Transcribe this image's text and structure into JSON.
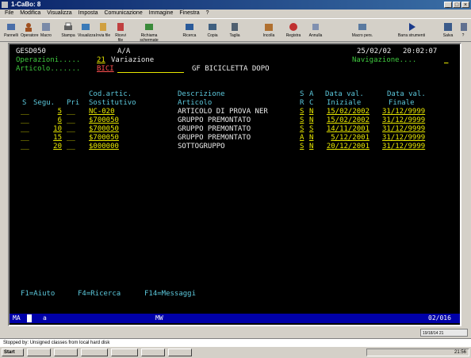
{
  "window": {
    "title": "1-CaBo: 8"
  },
  "menu": {
    "items": [
      "File",
      "Modifica",
      "Visualizza",
      "Imposta",
      "Comunicazione",
      "Immagine",
      "Finestra",
      "?"
    ]
  },
  "toolbar": {
    "buttons": [
      "Pannelli",
      "Operatore",
      "Macro",
      "Stampa",
      "Visualizza",
      "Invia file",
      "Ricevi file",
      "Richiama schermate",
      "Ricerca",
      "Copia",
      "Taglia",
      "Incolla",
      "Registra",
      "Annulla",
      "Macro pers.",
      "Barra strumenti",
      "Salva",
      "?"
    ]
  },
  "screen": {
    "program_id": "GESD050",
    "mode_code": "A/A",
    "date": "25/02/02",
    "time": "20:02:07",
    "operazioni_label": "Operazioni.....",
    "operazioni_value": "21",
    "operazioni_desc": "Variazione",
    "navigazione_label": "Navigazione....",
    "navigazione_value": "_",
    "articolo_label": "Articolo.......",
    "articolo_value": "BICI",
    "articolo_desc": "GF BICICLETTA DOPO",
    "headers_row1": {
      "cod": "Cod.artic.",
      "descr": "Descrizione",
      "s": "S",
      "a": "A",
      "dv1": "Data val.",
      "dv2": "Data val."
    },
    "headers_row2": {
      "s": "S",
      "segu": "Segu.",
      "pri": "Pri",
      "sost": "Sostitutivo",
      "articolo": "Articolo",
      "r": "R",
      "c": "C",
      "iniziale": "Iniziale",
      "finale": "Finale"
    },
    "rows": [
      {
        "seq": "5",
        "code": "NC-020",
        "descr": "ARTICOLO DI PROVA NER",
        "s": "S",
        "a": "N",
        "from": "15/02/2002",
        "to": "31/12/9999"
      },
      {
        "seq": "6",
        "code": "$700050",
        "descr": "GRUPPO PREMONTATO",
        "s": "S",
        "a": "N",
        "from": "15/02/2002",
        "to": "31/12/9999"
      },
      {
        "seq": "10",
        "code": "$700050",
        "descr": "GRUPPO PREMONTATO",
        "s": "S",
        "a": "S",
        "from": "14/11/2001",
        "to": "31/12/9999"
      },
      {
        "seq": "15",
        "code": "$700050",
        "descr": "GRUPPO PREMONTATO",
        "s": "A",
        "a": "N",
        "from": "5/12/2001",
        "to": "31/12/9999"
      },
      {
        "seq": "20",
        "code": "$000000",
        "descr": "SOTTOGRUPPO",
        "s": "S",
        "a": "N",
        "from": "20/12/2001",
        "to": "31/12/9999"
      }
    ],
    "fkeys": [
      "F1=Aiuto",
      "F4=Ricerca",
      "F14=Messaggi"
    ]
  },
  "oia": {
    "left": "MA",
    "mid": "a",
    "mode": "MW",
    "pos": "02/016"
  },
  "hint": "Stopped by: Unsigned classes from local hard disk",
  "statusbar": {
    "right": "19/18/14 21"
  },
  "taskbar": {
    "start": "Start",
    "items": [
      "",
      "",
      "",
      "",
      ""
    ],
    "clock": "21:56"
  },
  "colors": {
    "green": "#3ec83e",
    "cyan": "#5cc8dc",
    "yellow": "#e8e800",
    "titlebar": "#0a246a"
  }
}
